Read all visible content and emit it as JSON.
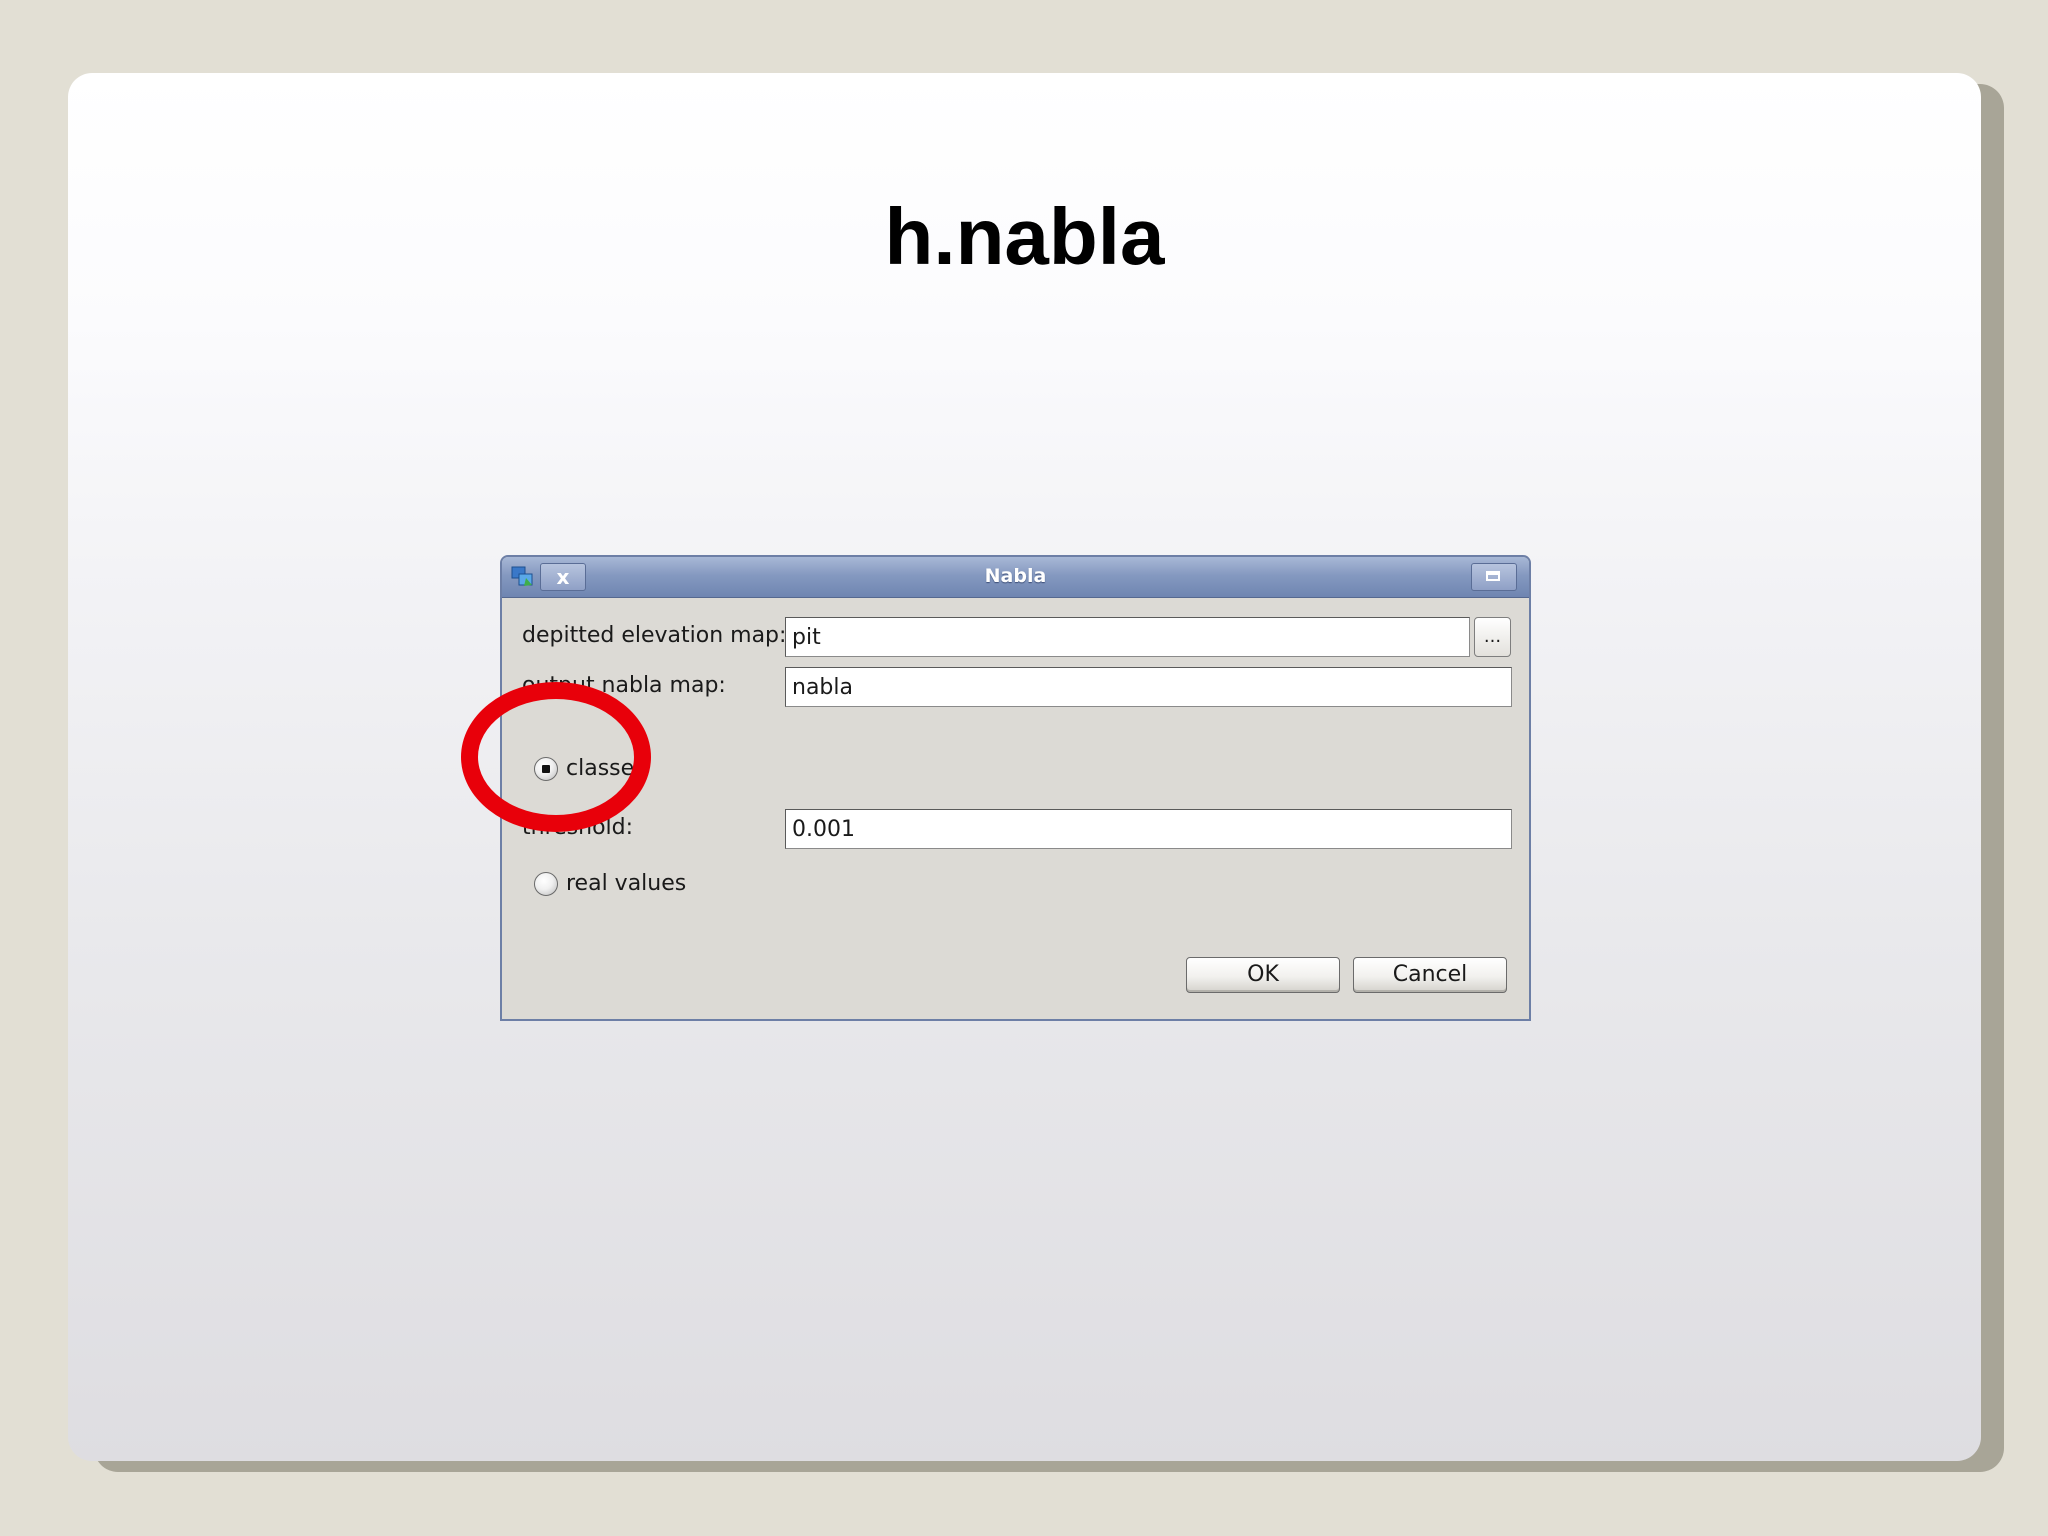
{
  "slide": {
    "title": "h.nabla"
  },
  "dialog": {
    "title": "Nabla",
    "close_glyph": "x",
    "fields": {
      "elevation_label": "depitted elevation map:",
      "elevation_value": "pit",
      "browse_label": "...",
      "output_label": "output nabla map:",
      "output_value": "nabla",
      "threshold_label": "threshold:",
      "threshold_value": "0.001"
    },
    "options": {
      "classes_label": "classes",
      "classes_selected": true,
      "real_values_label": "real values",
      "real_values_selected": false
    },
    "buttons": {
      "ok": "OK",
      "cancel": "Cancel"
    }
  },
  "annotation": {
    "highlight_color": "#e8000a"
  },
  "colors": {
    "background": "#e2dfd4",
    "titlebar": "#8599c0",
    "dialog_body": "#dcdad5"
  }
}
